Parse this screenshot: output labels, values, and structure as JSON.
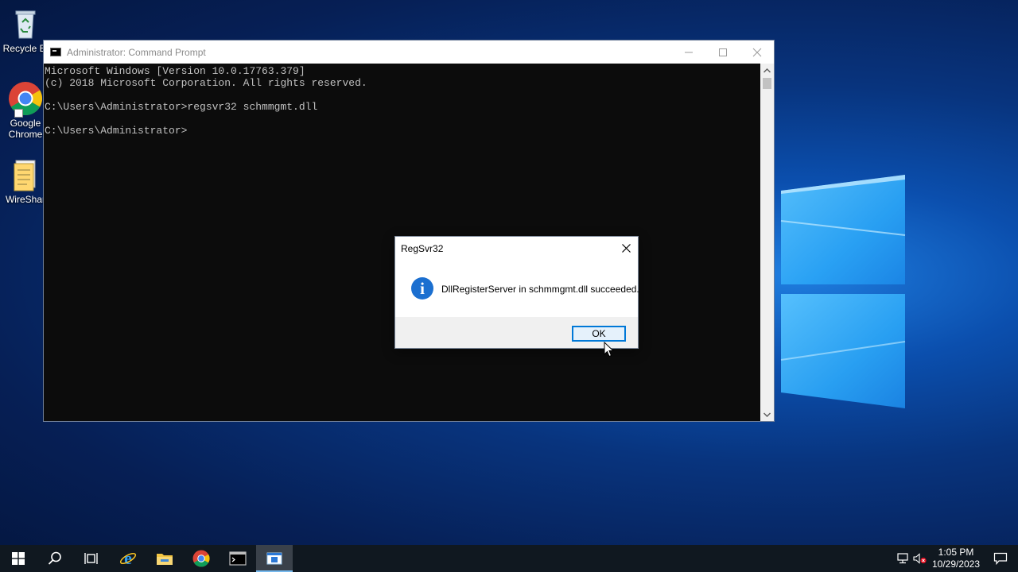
{
  "desktop": {
    "icons": [
      {
        "label": "Recycle Bi",
        "icon": "recycle-bin-icon"
      },
      {
        "label": "Google Chrome",
        "icon": "chrome-icon"
      },
      {
        "label": "WireShar",
        "icon": "wireshark-icon"
      }
    ]
  },
  "cmd_window": {
    "title": "Administrator: Command Prompt",
    "lines": [
      "Microsoft Windows [Version 10.0.17763.379]",
      "(c) 2018 Microsoft Corporation. All rights reserved.",
      "",
      "C:\\Users\\Administrator>regsvr32 schmmgmt.dll",
      "",
      "C:\\Users\\Administrator>"
    ],
    "buttons": {
      "minimize": "—",
      "maximize": "☐",
      "close": "✕"
    }
  },
  "dialog": {
    "title": "RegSvr32",
    "message": "DllRegisterServer in schmmgmt.dll succeeded.",
    "ok_label": "OK",
    "icon": "info-icon"
  },
  "taskbar": {
    "items": [
      "start-icon",
      "search-icon",
      "task-view-icon",
      "internet-explorer-icon",
      "file-explorer-icon",
      "chrome-icon",
      "command-prompt-icon",
      "regsvr32-icon"
    ],
    "active_item": "regsvr32-icon",
    "tray": {
      "time": "1:05 PM",
      "date": "10/29/2023"
    }
  },
  "colors": {
    "wallpaper": "#0b4fae",
    "accent": "#0078d7",
    "taskbar": "#101820"
  }
}
